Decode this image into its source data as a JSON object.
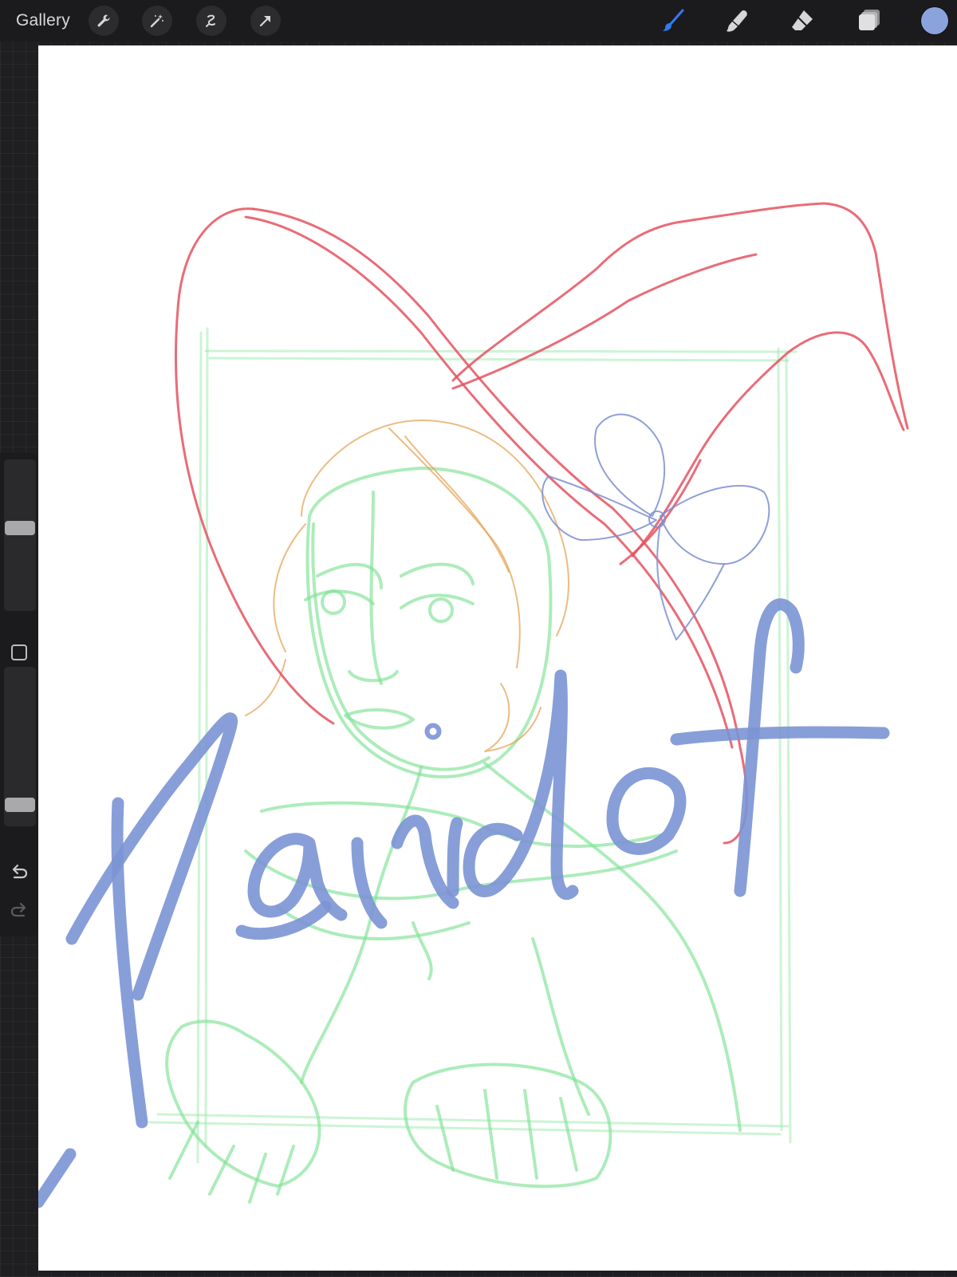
{
  "topbar": {
    "gallery_label": "Gallery",
    "left_tools": [
      "wrench-icon",
      "magic-wand-icon",
      "selection-icon",
      "transform-arrow-icon"
    ],
    "right_tools": {
      "brush": {
        "icon": "brush-icon",
        "active": true
      },
      "smudge": {
        "icon": "smudge-icon",
        "active": false
      },
      "eraser": {
        "icon": "eraser-icon",
        "active": false
      },
      "layers": {
        "icon": "layers-icon",
        "active": false
      }
    },
    "current_color": "#8ba3dd"
  },
  "sidebar": {
    "brush_size_level": 0.55,
    "opacity_level": 0.1,
    "modify_button_icon": "square-icon",
    "undo_icon": "undo-icon",
    "redo_icon": "redo-icon",
    "redo_enabled": false
  },
  "canvas": {
    "background": "#ffffff",
    "stroke_colors": {
      "guide_green": "#8ee6a0",
      "figure_green": "#7fe295",
      "hat_red": "#e5525f",
      "hair_orange": "#e3a04f",
      "bow_blue": "#7c8ed0",
      "signature_blue": "#7b93d4",
      "brush_active": "#2f7cf6"
    }
  }
}
